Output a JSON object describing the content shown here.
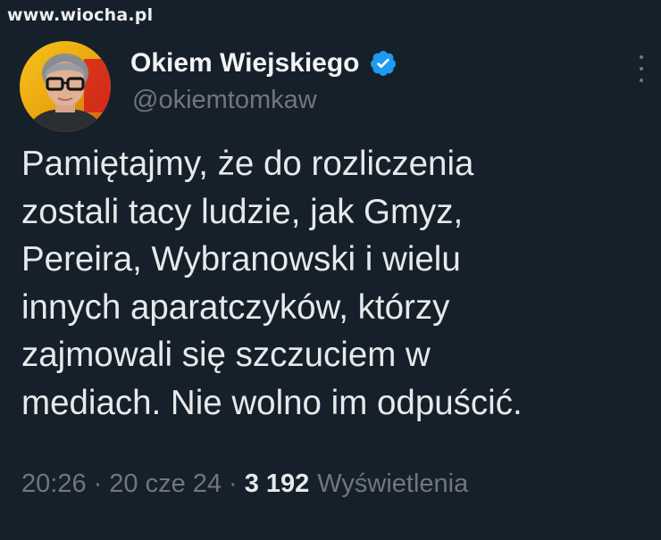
{
  "watermark": "www.wiocha.pl",
  "author": {
    "display_name": "Okiem Wiejskiego",
    "handle": "@okiemtomkaw",
    "verified_icon": "verified-badge-icon",
    "avatar_icon": "profile-avatar"
  },
  "more_icon": "more-options-icon",
  "tweet": {
    "lines": [
      "Pamiętajmy, że do rozliczenia",
      "zostali tacy ludzie, jak Gmyz,",
      "Pereira, Wybranowski i wielu",
      "innych aparatczyków, którzy",
      "zajmowali się szczuciem w",
      "mediach. Nie wolno im odpuścić."
    ]
  },
  "meta": {
    "time": "20:26",
    "separator": "·",
    "date": "20 cze 24",
    "views_count": "3 192",
    "views_label": "Wyświetlenia"
  },
  "colors": {
    "background": "#15202b",
    "text": "#e7e9ea",
    "secondary": "#71767b",
    "verified": "#1d9bf0"
  }
}
